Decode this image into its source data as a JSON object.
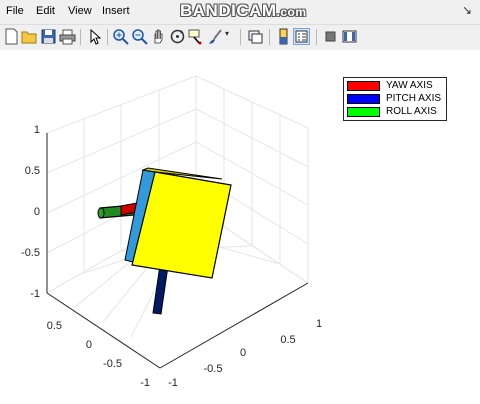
{
  "menu": {
    "items": [
      {
        "label": "File"
      },
      {
        "label": "Edit"
      },
      {
        "label": "View"
      },
      {
        "label": "Insert"
      }
    ]
  },
  "watermark": {
    "brand": "BANDICAM",
    "tail": ".com"
  },
  "toolbar": {
    "buttons": [
      {
        "icon": "new-figure-icon"
      },
      {
        "icon": "open-file-icon"
      },
      {
        "icon": "save-icon"
      },
      {
        "icon": "print-icon"
      },
      {
        "icon": "edit-plot-arrow-icon"
      },
      {
        "icon": "zoom-in-icon"
      },
      {
        "icon": "zoom-out-icon"
      },
      {
        "icon": "pan-hand-icon"
      },
      {
        "icon": "rotate-3d-icon"
      },
      {
        "icon": "data-cursor-icon"
      },
      {
        "icon": "brush-icon"
      },
      {
        "icon": "link-plot-icon"
      },
      {
        "icon": "colorbar-icon"
      },
      {
        "icon": "legend-icon"
      },
      {
        "icon": "hide-plot-tools-icon"
      },
      {
        "icon": "show-plot-tools-icon"
      }
    ]
  },
  "axes": {
    "z_ticks": [
      "1",
      "0.5",
      "0",
      "-0.5",
      "-1"
    ],
    "y_ticks": [
      "0.5",
      "0",
      "-0.5",
      "-1"
    ],
    "x_ticks": [
      "-1",
      "-0.5",
      "0",
      "0.5",
      "1"
    ],
    "grid": true
  },
  "legend": {
    "entries": [
      {
        "label": "YAW AXIS",
        "color": "#ff0000"
      },
      {
        "label": "PITCH AXIS",
        "color": "#0000ff"
      },
      {
        "label": "ROLL AXIS",
        "color": "#00ff00"
      }
    ]
  },
  "colors": {
    "box_face": "#ffff00",
    "box_side": "#3399dd",
    "box_edge": "#000000",
    "roll_bar": "#228b22",
    "yaw_bar": "#cc0000",
    "pitch_bar": "#001a66"
  }
}
